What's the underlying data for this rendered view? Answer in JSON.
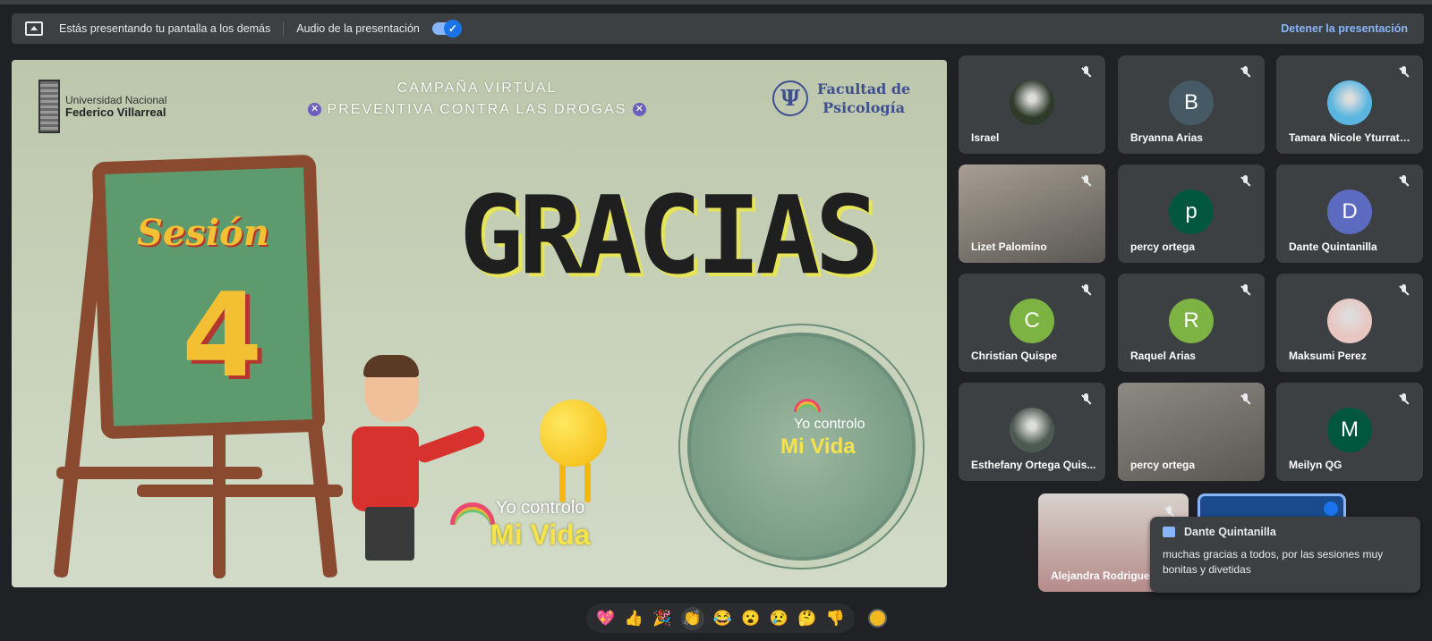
{
  "banner": {
    "presenting_text": "Estás presentando tu pantalla a los demás",
    "audio_label": "Audio de la presentación",
    "audio_enabled": true,
    "stop_label": "Detener la presentación"
  },
  "slide": {
    "university_line1": "Universidad Nacional",
    "university_line2": "Federico Villarreal",
    "campaign_line1": "CAMPAÑA VIRTUAL",
    "campaign_line2": "PREVENTIVA CONTRA LAS DROGAS",
    "faculty_line1": "Facultad de",
    "faculty_line2": "Psicología",
    "session_label": "Sesión",
    "session_number": "4",
    "headline": "GRACIAS",
    "logo_line1": "Yo controlo",
    "logo_line2": "Mi Vida",
    "circle_logo_line1": "Yo controlo",
    "circle_logo_line2": "Mi Vida"
  },
  "participants": [
    {
      "name": "Israel",
      "type": "photo",
      "color": "#2f3b2a"
    },
    {
      "name": "Bryanna Arias",
      "type": "initial",
      "initial": "B",
      "color": "#455a64"
    },
    {
      "name": "Tamara Nicole Yturrate ...",
      "type": "photo",
      "color": "#5ab6e0"
    },
    {
      "name": "Lizet Palomino",
      "type": "video",
      "color": "#a89f93"
    },
    {
      "name": "percy ortega",
      "type": "initial",
      "initial": "p",
      "color": "#00573e"
    },
    {
      "name": "Dante Quintanilla",
      "type": "initial",
      "initial": "D",
      "color": "#5c6bc0"
    },
    {
      "name": "Christian Quispe",
      "type": "initial",
      "initial": "C",
      "color": "#7cb342"
    },
    {
      "name": "Raquel Arias",
      "type": "initial",
      "initial": "R",
      "color": "#7cb342"
    },
    {
      "name": "Maksumi Perez",
      "type": "photo",
      "color": "#e8c7c2"
    },
    {
      "name": "Esthefany Ortega Quis...",
      "type": "photo",
      "color": "#4d5a52"
    },
    {
      "name": "percy ortega",
      "type": "video",
      "color": "#8d8a84"
    },
    {
      "name": "Meilyn QG",
      "type": "initial",
      "initial": "M",
      "color": "#00573e"
    }
  ],
  "self_tile": {
    "name": "Alejandra Rodriguez"
  },
  "chat_toast": {
    "sender": "Dante Quintanilla",
    "message": "muchas gracias a todos, por las sesiones muy bonitas y divetidas"
  },
  "reactions": [
    "💖",
    "👍",
    "🎉",
    "👏",
    "😂",
    "😮",
    "😢",
    "🤔",
    "👎"
  ]
}
